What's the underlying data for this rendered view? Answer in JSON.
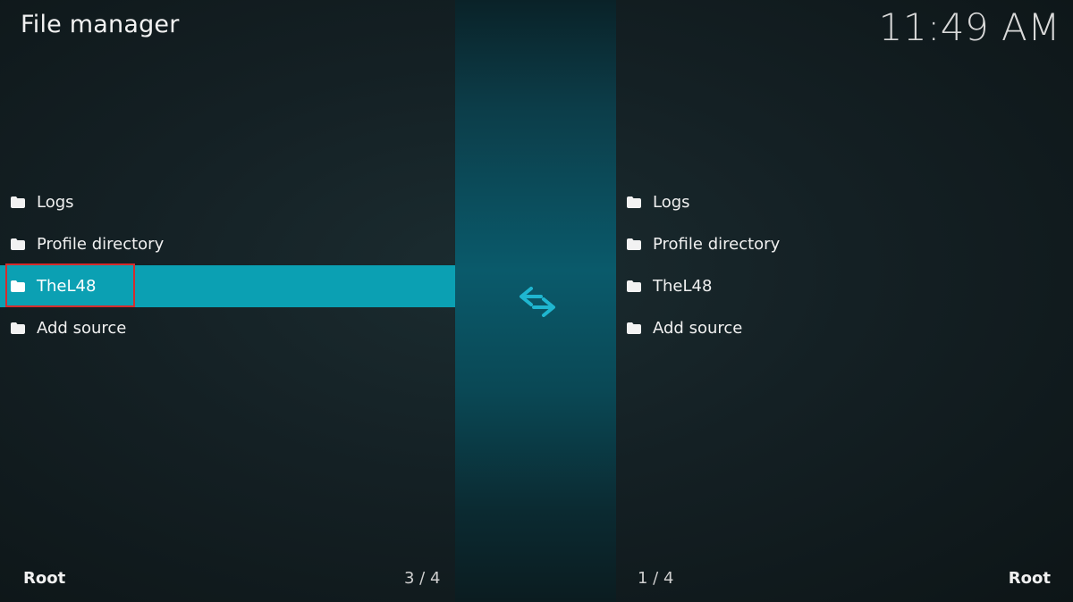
{
  "header": {
    "title": "File manager",
    "clock": "11:49 AM"
  },
  "left_pane": {
    "items": [
      {
        "label": "Logs",
        "icon": "folder-icon"
      },
      {
        "label": "Profile directory",
        "icon": "folder-icon"
      },
      {
        "label": "TheL48",
        "icon": "folder-icon",
        "selected": true
      },
      {
        "label": "Add source",
        "icon": "folder-icon"
      }
    ],
    "footer_path": "Root",
    "footer_count": "3 / 4"
  },
  "right_pane": {
    "items": [
      {
        "label": "Logs",
        "icon": "folder-icon"
      },
      {
        "label": "Profile directory",
        "icon": "folder-icon"
      },
      {
        "label": "TheL48",
        "icon": "folder-icon"
      },
      {
        "label": "Add source",
        "icon": "folder-icon"
      }
    ],
    "footer_path": "Root",
    "footer_count": "1 / 4"
  },
  "center": {
    "icon": "swap-arrows-icon"
  },
  "colors": {
    "accent": "#0ba0b3",
    "highlight_outline": "#d62c2c"
  }
}
